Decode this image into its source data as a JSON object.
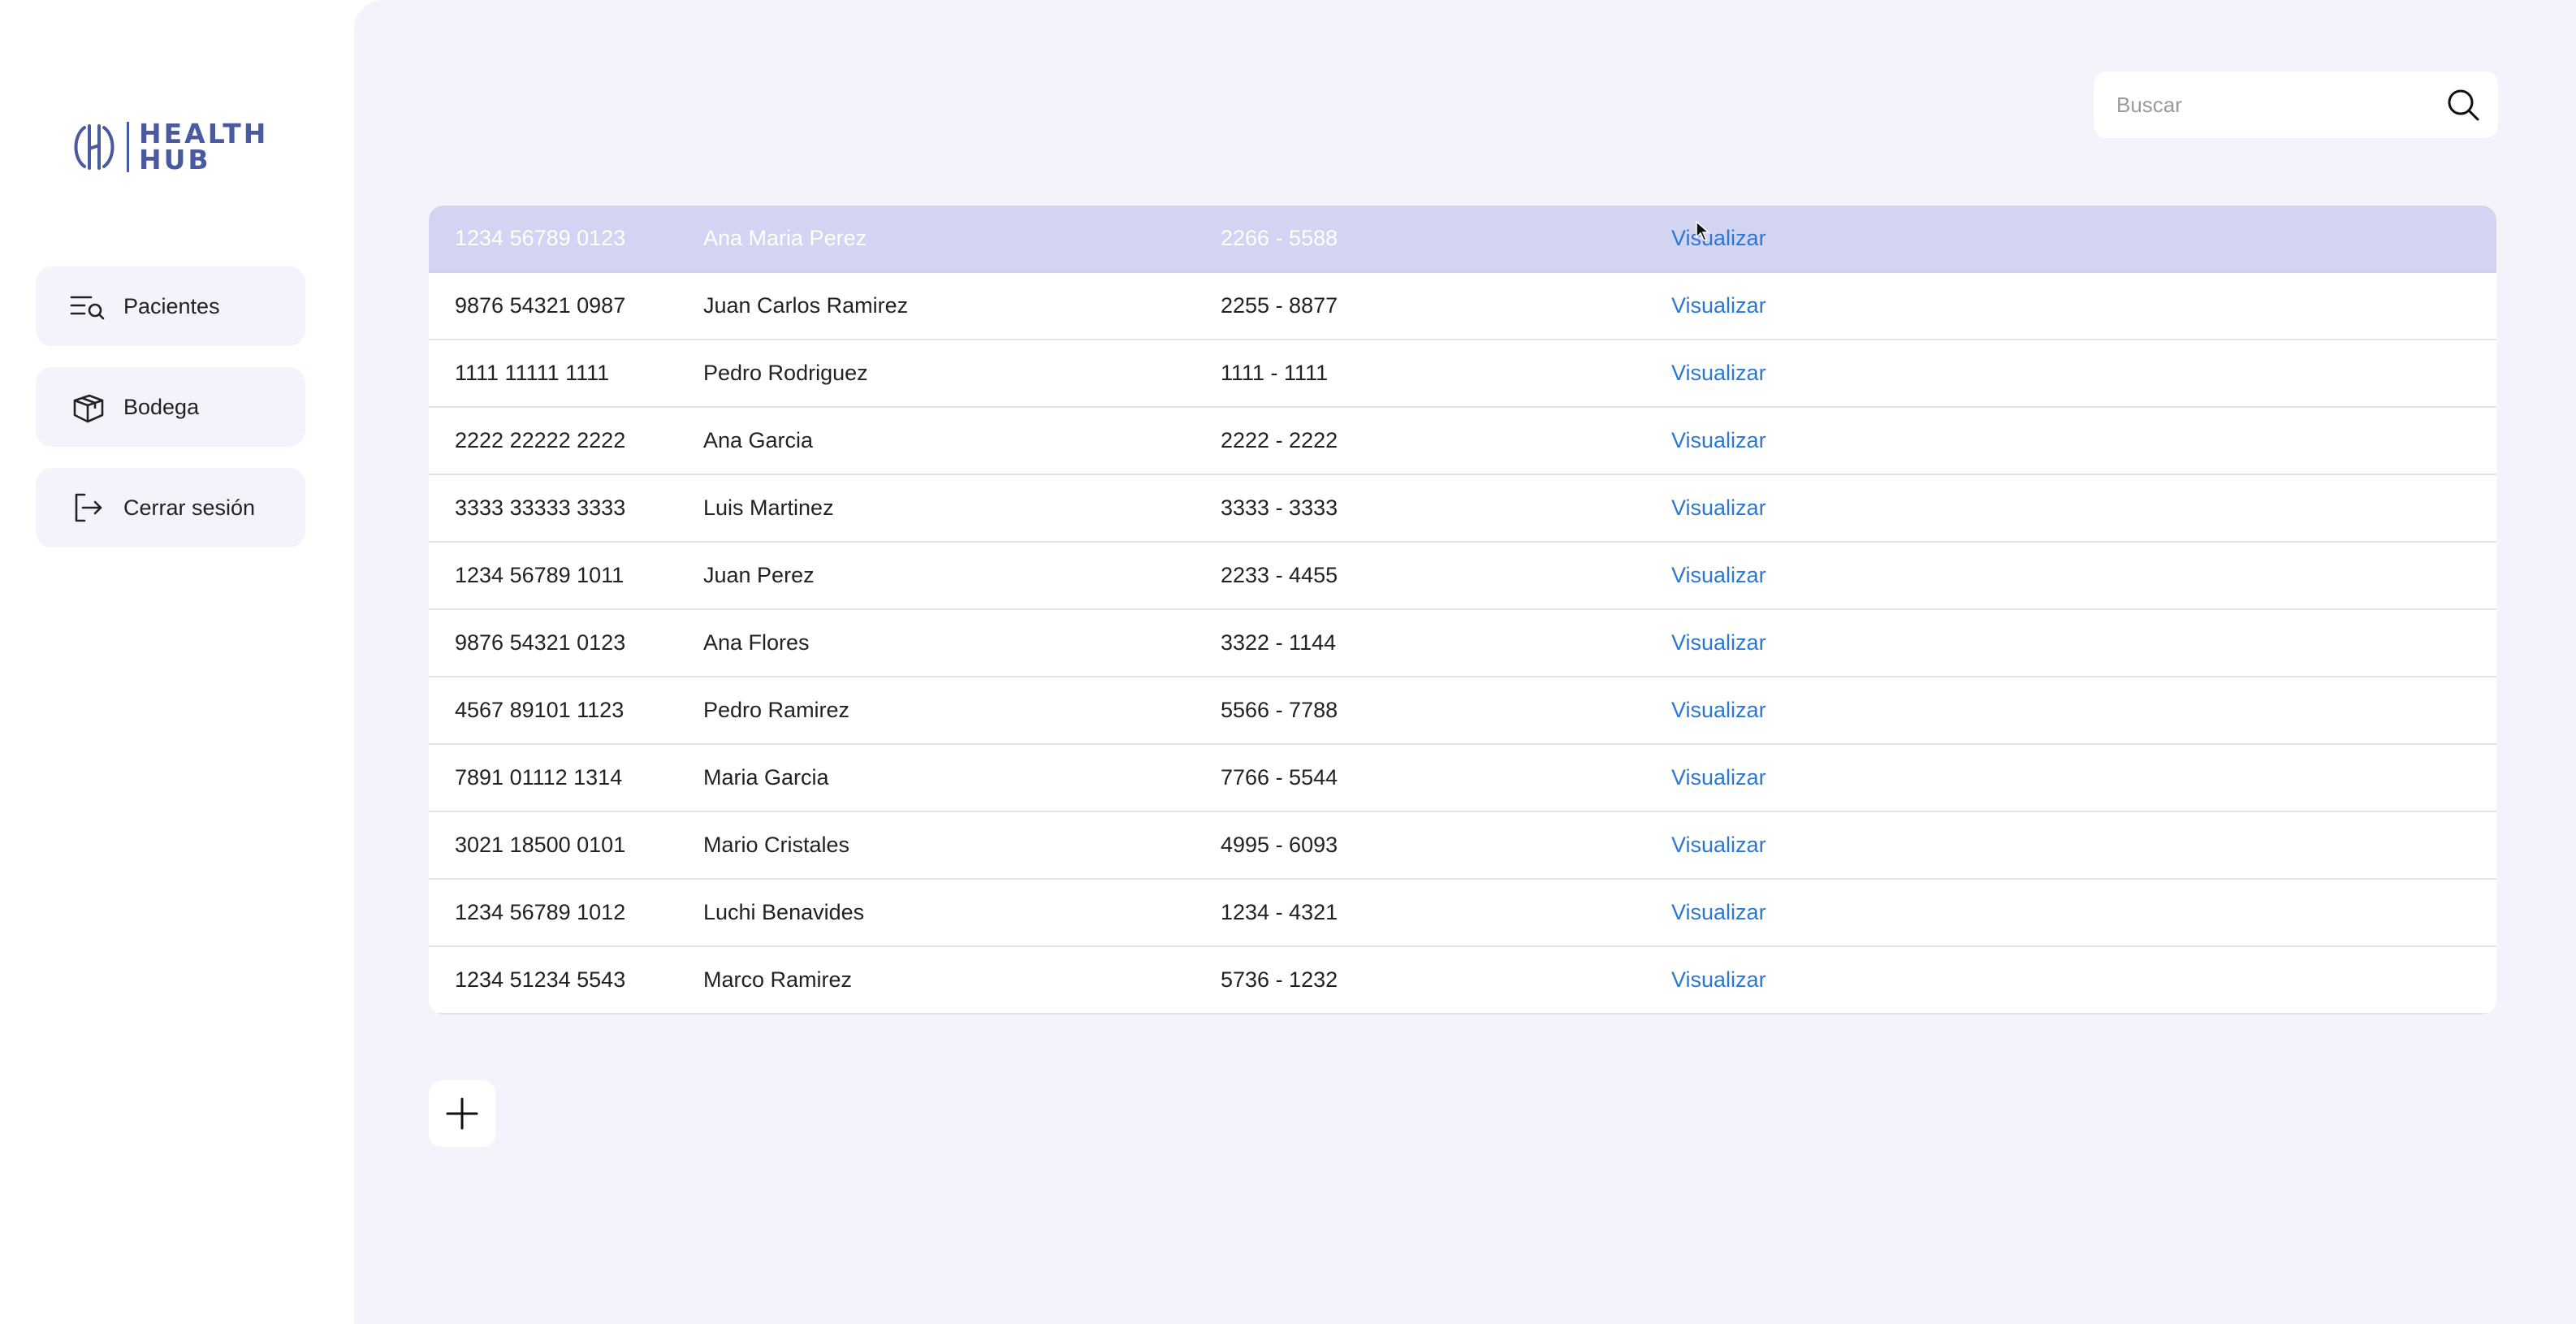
{
  "brand": {
    "line1": "HEALTH",
    "line2": "HUB",
    "color": "#4a5aa0"
  },
  "sidebar": {
    "items": [
      {
        "label": "Pacientes",
        "icon": "patients-search-icon"
      },
      {
        "label": "Bodega",
        "icon": "box-icon"
      },
      {
        "label": "Cerrar sesión",
        "icon": "logout-icon"
      }
    ]
  },
  "search": {
    "placeholder": "Buscar",
    "value": ""
  },
  "patients": {
    "rows": [
      {
        "id": "1234 56789 0123",
        "name": "Ana Maria Perez",
        "phone": "2266 - 5588",
        "action": "Visualizar"
      },
      {
        "id": "9876 54321 0987",
        "name": "Juan Carlos Ramirez",
        "phone": "2255 - 8877",
        "action": "Visualizar"
      },
      {
        "id": "1111 11111 1111",
        "name": "Pedro Rodriguez",
        "phone": "1111 - 1111",
        "action": "Visualizar"
      },
      {
        "id": "2222 22222 2222",
        "name": "Ana Garcia",
        "phone": "2222 - 2222",
        "action": "Visualizar"
      },
      {
        "id": "3333 33333 3333",
        "name": "Luis Martinez",
        "phone": "3333 - 3333",
        "action": "Visualizar"
      },
      {
        "id": "1234 56789 1011",
        "name": "Juan Perez",
        "phone": "2233 - 4455",
        "action": "Visualizar"
      },
      {
        "id": "9876 54321 0123",
        "name": "Ana Flores",
        "phone": "3322 - 1144",
        "action": "Visualizar"
      },
      {
        "id": "4567 89101 1123",
        "name": "Pedro Ramirez",
        "phone": "5566 - 7788",
        "action": "Visualizar"
      },
      {
        "id": "7891 01112 1314",
        "name": "Maria Garcia",
        "phone": "7766 - 5544",
        "action": "Visualizar"
      },
      {
        "id": "3021 18500 0101",
        "name": "Mario Cristales",
        "phone": "4995 - 6093",
        "action": "Visualizar"
      },
      {
        "id": "1234 56789 1012",
        "name": "Luchi Benavides",
        "phone": "1234 - 4321",
        "action": "Visualizar"
      },
      {
        "id": "1234 51234 5543",
        "name": "Marco Ramirez",
        "phone": "5736 - 1232",
        "action": "Visualizar"
      }
    ]
  },
  "colors": {
    "selected_row": "#d3d4f1",
    "link": "#2a78d6",
    "main_bg": "#f3f4fb"
  }
}
